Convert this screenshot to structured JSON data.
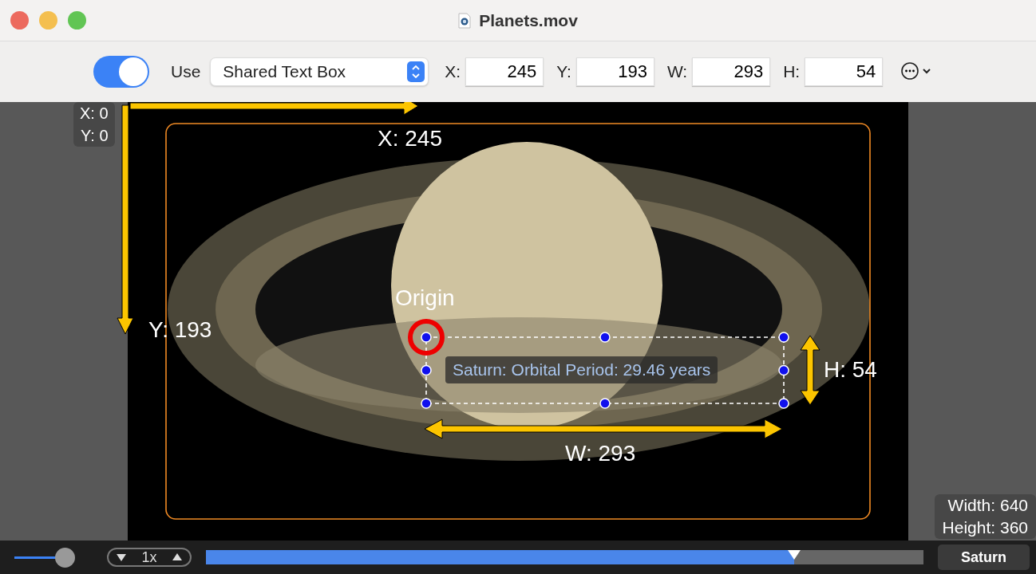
{
  "window": {
    "title": "Planets.mov"
  },
  "toolbar": {
    "enabled": true,
    "use_label": "Use",
    "text_box_select": "Shared Text Box",
    "fields": [
      {
        "label": "X:",
        "value": "245"
      },
      {
        "label": "Y:",
        "value": "193"
      },
      {
        "label": "W:",
        "value": "293"
      },
      {
        "label": "H:",
        "value": "54"
      }
    ]
  },
  "video": {
    "origin_badge": [
      "X: 0",
      "Y: 0"
    ],
    "size_badge": [
      "Width: 640",
      "Height: 360"
    ],
    "text_box": "Saturn: Orbital Period: 29.46 years"
  },
  "annotations": {
    "x_label": "X: 245",
    "y_label": "Y: 193",
    "origin_label": "Origin",
    "w_label": "W: 293",
    "h_label": "H: 54"
  },
  "playback": {
    "volume": {
      "level": 0.85
    },
    "speed": "1x",
    "progress": {
      "level": 0.82
    },
    "chapter": "Saturn"
  }
}
